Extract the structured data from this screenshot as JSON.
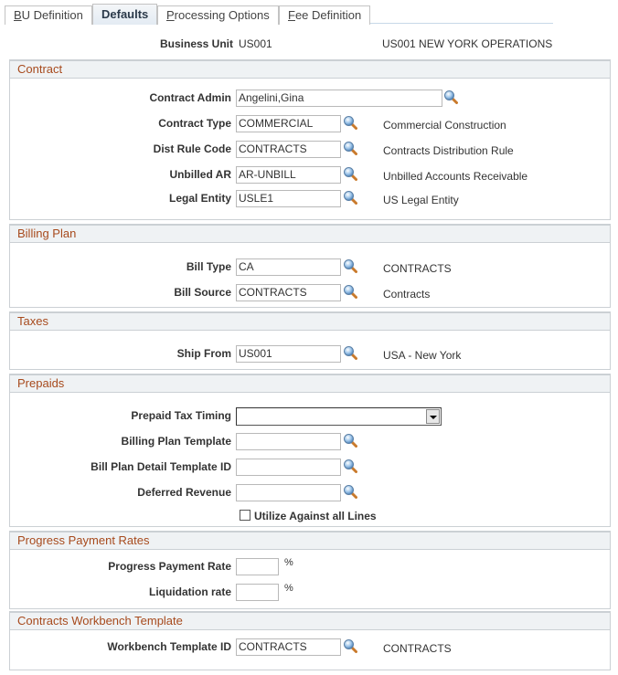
{
  "tabs": [
    {
      "label_first": "B",
      "label_rest": "U Definition",
      "active": false
    },
    {
      "label_first": "",
      "label_rest": "Defaults",
      "active": true
    },
    {
      "label_first": "P",
      "label_rest": "rocessing Options",
      "active": false
    },
    {
      "label_first": "F",
      "label_rest": "ee Definition",
      "active": false
    }
  ],
  "header": {
    "business_unit_label": "Business Unit",
    "business_unit_value": "US001",
    "business_unit_desc": "US001 NEW YORK OPERATIONS"
  },
  "sections": {
    "contract": {
      "title": "Contract",
      "fields": {
        "contract_admin": {
          "label": "Contract Admin",
          "value": "Angelini,Gina",
          "desc": ""
        },
        "contract_type": {
          "label": "Contract Type",
          "value": "COMMERCIAL",
          "desc": "Commercial Construction"
        },
        "dist_rule_code": {
          "label": "Dist Rule Code",
          "value": "CONTRACTS",
          "desc": "Contracts Distribution Rule"
        },
        "unbilled_ar": {
          "label": "Unbilled AR",
          "value": "AR-UNBILL",
          "desc": "Unbilled Accounts Receivable"
        },
        "legal_entity": {
          "label": "Legal Entity",
          "value": "USLE1",
          "desc": "US Legal Entity"
        }
      }
    },
    "billing_plan": {
      "title": "Billing Plan",
      "fields": {
        "bill_type": {
          "label": "Bill Type",
          "value": "CA",
          "desc": "CONTRACTS"
        },
        "bill_source": {
          "label": "Bill Source",
          "value": "CONTRACTS",
          "desc": "Contracts"
        }
      }
    },
    "taxes": {
      "title": "Taxes",
      "fields": {
        "ship_from": {
          "label": "Ship From",
          "value": "US001",
          "desc": "USA - New York"
        }
      }
    },
    "prepaids": {
      "title": "Prepaids",
      "fields": {
        "prepaid_tax_timing": {
          "label": "Prepaid Tax Timing",
          "value": ""
        },
        "billing_plan_template": {
          "label": "Billing Plan Template",
          "value": ""
        },
        "bill_plan_detail_template_id": {
          "label": "Bill Plan Detail Template ID",
          "value": ""
        },
        "deferred_revenue": {
          "label": "Deferred Revenue",
          "value": ""
        },
        "utilize_against_all_lines": {
          "label": "Utilize Against all Lines",
          "checked": false
        }
      }
    },
    "progress_payment_rates": {
      "title": "Progress Payment Rates",
      "fields": {
        "progress_payment_rate": {
          "label": "Progress Payment Rate",
          "value": "",
          "unit": "%"
        },
        "liquidation_rate": {
          "label": "Liquidation rate",
          "value": "",
          "unit": "%"
        }
      }
    },
    "workbench": {
      "title": "Contracts Workbench Template",
      "fields": {
        "workbench_template_id": {
          "label": "Workbench Template ID",
          "value": "CONTRACTS",
          "desc": "CONTRACTS"
        }
      }
    }
  },
  "icons": {
    "prompt": "magnifier-lookup-icon",
    "dropdown": "chevron-down-icon",
    "checkbox": "checkbox-unchecked"
  },
  "colors": {
    "section_title": "#a74a1d",
    "section_header_bg": "#eff2f4",
    "border": "#cbd0d4"
  }
}
